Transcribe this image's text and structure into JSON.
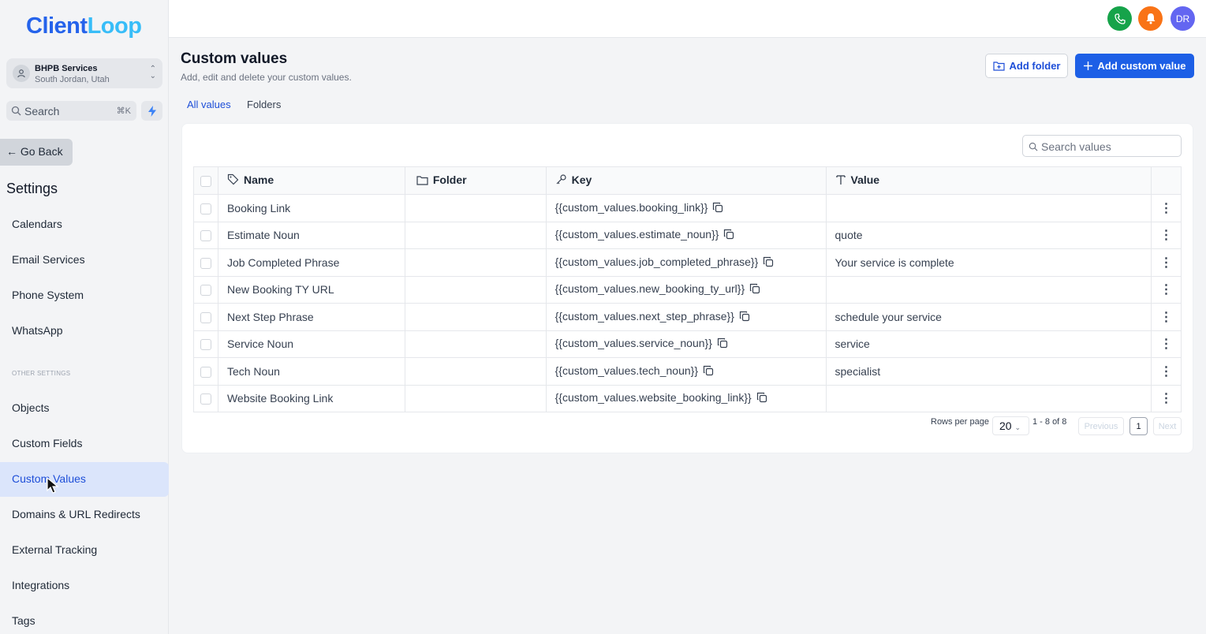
{
  "app": {
    "logo_part1": "Client",
    "logo_part2": "Loop",
    "brand_color": "#2563eb"
  },
  "account": {
    "name": "BHPB Services",
    "location": "South Jordan, Utah"
  },
  "sidebar": {
    "search_placeholder": "Search",
    "search_shortcut": "⌘K",
    "go_back": "Go Back",
    "settings_title": "Settings",
    "items": [
      {
        "label": "Calendars"
      },
      {
        "label": "Email Services"
      },
      {
        "label": "Phone System"
      },
      {
        "label": "WhatsApp"
      }
    ],
    "section_label": "OTHER SETTINGS",
    "other_items": [
      {
        "label": "Objects"
      },
      {
        "label": "Custom Fields"
      },
      {
        "label": "Custom Values",
        "active": true
      },
      {
        "label": "Domains & URL Redirects"
      },
      {
        "label": "External Tracking"
      },
      {
        "label": "Integrations"
      },
      {
        "label": "Tags"
      }
    ]
  },
  "topbar": {
    "phone_color": "#16a34a",
    "notification_color": "#f97316",
    "avatar_initials": "DR",
    "avatar_color": "#6366f1"
  },
  "page": {
    "title": "Custom values",
    "subtitle": "Add, edit and delete your custom values.",
    "add_folder_label": "Add folder",
    "add_value_label": "Add custom value",
    "tabs": [
      {
        "label": "All values",
        "active": true
      },
      {
        "label": "Folders",
        "active": false
      }
    ],
    "search_placeholder": "Search values"
  },
  "table": {
    "headers": {
      "name": "Name",
      "folder": "Folder",
      "key": "Key",
      "value": "Value"
    },
    "rows": [
      {
        "name": "Booking Link",
        "folder": "",
        "key": "{{custom_values.booking_link}}",
        "value": ""
      },
      {
        "name": "Estimate Noun",
        "folder": "",
        "key": "{{custom_values.estimate_noun}}",
        "value": "quote"
      },
      {
        "name": "Job Completed Phrase",
        "folder": "",
        "key": "{{custom_values.job_completed_phrase}}",
        "value": "Your service is complete"
      },
      {
        "name": "New Booking TY URL",
        "folder": "",
        "key": "{{custom_values.new_booking_ty_url}}",
        "value": ""
      },
      {
        "name": "Next Step Phrase",
        "folder": "",
        "key": "{{custom_values.next_step_phrase}}",
        "value": "schedule your service"
      },
      {
        "name": "Service Noun",
        "folder": "",
        "key": "{{custom_values.service_noun}}",
        "value": "service"
      },
      {
        "name": "Tech Noun",
        "folder": "",
        "key": "{{custom_values.tech_noun}}",
        "value": "specialist"
      },
      {
        "name": "Website Booking Link",
        "folder": "",
        "key": "{{custom_values.website_booking_link}}",
        "value": ""
      }
    ]
  },
  "pagination": {
    "rows_per_page_label": "Rows per page",
    "rows_per_page": "20",
    "range": "1 - 8 of 8",
    "previous": "Previous",
    "page": "1",
    "next": "Next"
  }
}
